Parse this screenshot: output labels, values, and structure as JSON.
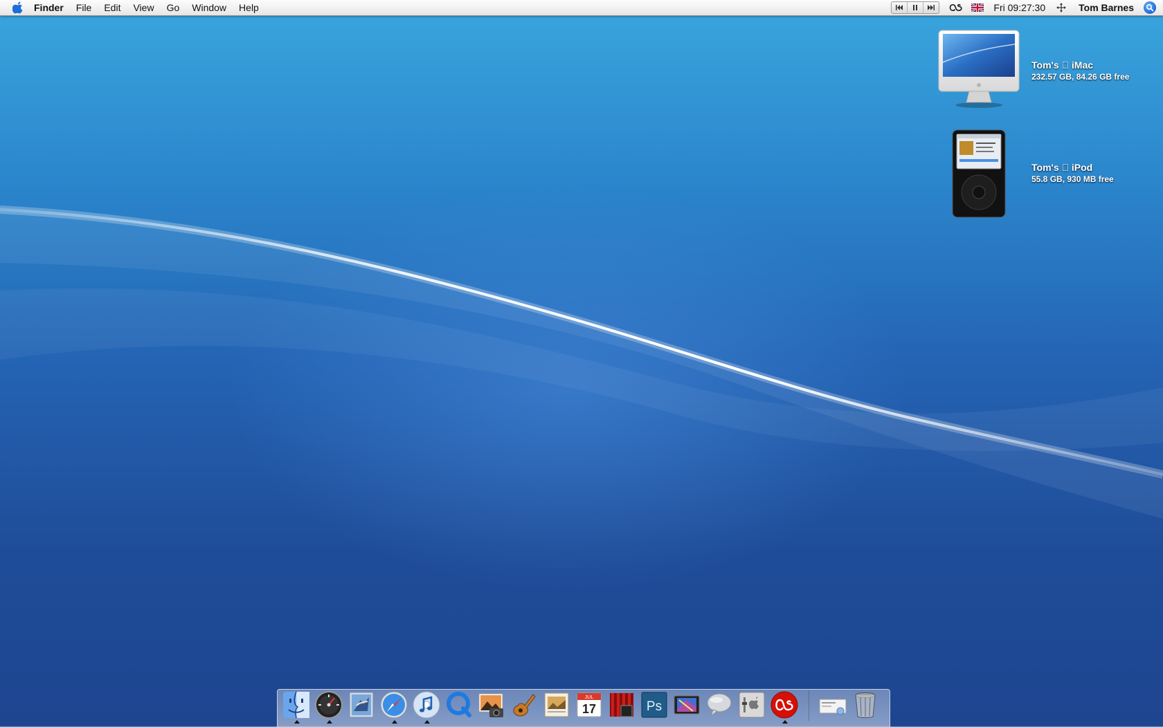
{
  "menubar": {
    "apple_icon": "apple-logo-icon",
    "app_name": "Finder",
    "menus": [
      "File",
      "Edit",
      "View",
      "Go",
      "Window",
      "Help"
    ],
    "clock": "Fri 09:27:30",
    "user": "Tom Barnes",
    "status_icons": [
      "itunes-previous-icon",
      "itunes-pause-icon",
      "itunes-next-icon",
      "lastfm-icon",
      "uk-flag-icon",
      "move-arrows-icon",
      "spotlight-icon"
    ]
  },
  "desktop": {
    "items": [
      {
        "name": "Tom's  iMac",
        "info": "232.57 GB, 84.26 GB free",
        "icon": "imac-icon"
      },
      {
        "name": "Tom's  iPod",
        "info": "55.8 GB, 930 MB free",
        "icon": "ipod-icon"
      }
    ]
  },
  "colors": {
    "desktop_top": "#3aa6de",
    "desktop_bottom": "#1e4590",
    "menubar": "#f2f2f2"
  },
  "dock": {
    "apps": [
      "Finder",
      "Dashboard",
      "Mail",
      "Safari",
      "iTunes",
      "QuickTime Player",
      "iPhoto",
      "GarageBand",
      "Preview",
      "iCal",
      "Front Row",
      "Photoshop",
      "iDVD",
      "iChat",
      "System Preferences",
      "Last.fm"
    ],
    "running": [
      "Finder",
      "Dashboard",
      "Safari",
      "iTunes",
      "Last.fm"
    ],
    "ical_date": "17",
    "ical_month": "JUL",
    "photoshop_label": "Ps",
    "right_items": [
      "Documents stack",
      "Trash"
    ]
  }
}
